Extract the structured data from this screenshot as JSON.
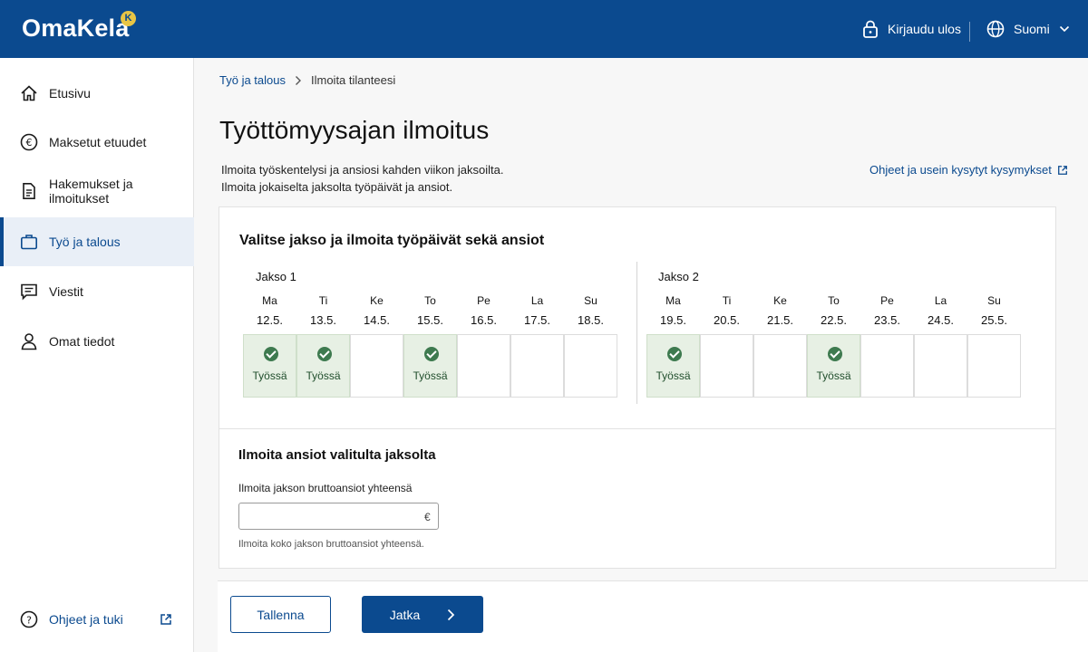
{
  "app": {
    "logo": "OmaKela",
    "logo_badge": "K"
  },
  "header": {
    "logout_label": "Kirjaudu ulos",
    "language_label": "Suomi"
  },
  "sidebar": {
    "items": [
      {
        "label": "Etusivu",
        "icon": "home-icon",
        "active": false
      },
      {
        "label": "Maksetut etuudet",
        "icon": "euro-icon",
        "active": false
      },
      {
        "label": "Hakemukset ja ilmoitukset",
        "icon": "document-icon",
        "active": false
      },
      {
        "label": "Työ ja talous",
        "icon": "briefcase-icon",
        "active": true
      },
      {
        "label": "Viestit",
        "icon": "message-icon",
        "active": false
      },
      {
        "label": "Omat tiedot",
        "icon": "person-icon",
        "active": false
      }
    ],
    "help_label": "Ohjeet ja tuki"
  },
  "breadcrumb": {
    "parent": "Työ ja talous",
    "current": "Ilmoita tilanteesi"
  },
  "page": {
    "title": "Työttömyysajan ilmoitus",
    "intro_line1": "Ilmoita työskentelysi ja ansiosi kahden viikon jaksoilta.",
    "intro_line2": "Ilmoita jokaiselta jaksolta työpäivät ja ansiot.",
    "faq_link": "Ohjeet ja usein kysytyt kysymykset"
  },
  "calendar": {
    "heading": "Valitse jakso ja ilmoita työpäivät sekä ansiot",
    "worked_label": "Työssä",
    "periods": [
      {
        "title": "Jakso 1",
        "days": [
          {
            "name": "Ma",
            "date": "12.5.",
            "worked": true
          },
          {
            "name": "Ti",
            "date": "13.5.",
            "worked": true
          },
          {
            "name": "Ke",
            "date": "14.5.",
            "worked": false
          },
          {
            "name": "To",
            "date": "15.5.",
            "worked": true
          },
          {
            "name": "Pe",
            "date": "16.5.",
            "worked": false
          },
          {
            "name": "La",
            "date": "17.5.",
            "worked": false
          },
          {
            "name": "Su",
            "date": "18.5.",
            "worked": false
          }
        ]
      },
      {
        "title": "Jakso 2",
        "days": [
          {
            "name": "Ma",
            "date": "19.5.",
            "worked": true
          },
          {
            "name": "Ti",
            "date": "20.5.",
            "worked": false
          },
          {
            "name": "Ke",
            "date": "21.5.",
            "worked": false
          },
          {
            "name": "To",
            "date": "22.5.",
            "worked": true
          },
          {
            "name": "Pe",
            "date": "23.5.",
            "worked": false
          },
          {
            "name": "La",
            "date": "24.5.",
            "worked": false
          },
          {
            "name": "Su",
            "date": "25.5.",
            "worked": false
          }
        ]
      }
    ]
  },
  "earnings": {
    "heading": "Ilmoita ansiot valitulta jaksolta",
    "field_label": "Ilmoita jakson bruttoansiot yhteensä",
    "value": "",
    "currency": "€",
    "hint": "Ilmoita koko jakson bruttoansiot yhteensä."
  },
  "actions": {
    "save_label": "Tallenna",
    "next_label": "Jatka"
  },
  "colors": {
    "brand": "#0b4a8f",
    "worked_bg": "#e7f0e4",
    "worked_check": "#3e7a4f"
  }
}
